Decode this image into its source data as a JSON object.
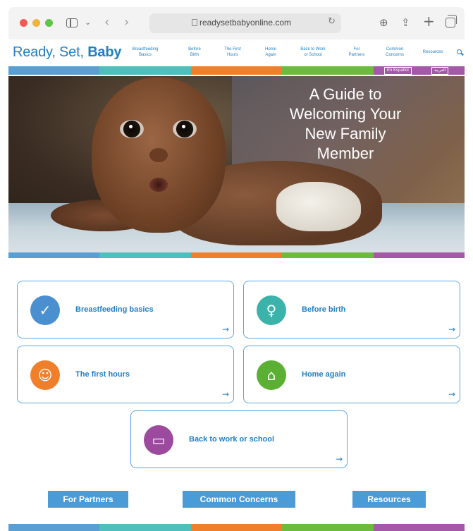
{
  "browser": {
    "url": "readysetbabyonline.com"
  },
  "site": {
    "logo_ready": "Ready, Set,",
    "logo_baby": "Baby",
    "nav": [
      {
        "line1": "Breastfeeding",
        "line2": "Basics"
      },
      {
        "line1": "Before",
        "line2": "Birth"
      },
      {
        "line1": "The First",
        "line2": "Hours"
      },
      {
        "line1": "Home",
        "line2": "Again"
      },
      {
        "line1": "Back to Work",
        "line2": "or School"
      },
      {
        "line1": "For",
        "line2": "Partners"
      },
      {
        "line1": "Common",
        "line2": "Concerns"
      },
      {
        "line1": "Resources",
        "line2": ""
      }
    ],
    "lang_es": "En Español",
    "lang_ar": "العربية"
  },
  "hero": {
    "title": "A Guide to Welcoming Your New Family Member"
  },
  "cards": [
    {
      "label": "Breastfeeding basics",
      "icon": "check-badge-icon",
      "color": "#4a8fd0"
    },
    {
      "label": "Before birth",
      "icon": "pregnant-icon",
      "color": "#3bb3aa"
    },
    {
      "label": "The first hours",
      "icon": "parent-baby-icon",
      "color": "#f07f2c"
    },
    {
      "label": "Home again",
      "icon": "house-heart-icon",
      "color": "#5bb033"
    },
    {
      "label": "Back to work or school",
      "icon": "laptop-icon",
      "color": "#9b4a9e"
    }
  ],
  "bottom_buttons": {
    "partners": "For Partners",
    "concerns": "Common Concerns",
    "resources": "Resources"
  },
  "colors": {
    "brand_blue": "#1f7fc4",
    "stripe": [
      "#5a9fd4",
      "#4fbfbd",
      "#f07f2c",
      "#6cbb3c",
      "#a658a8"
    ]
  }
}
